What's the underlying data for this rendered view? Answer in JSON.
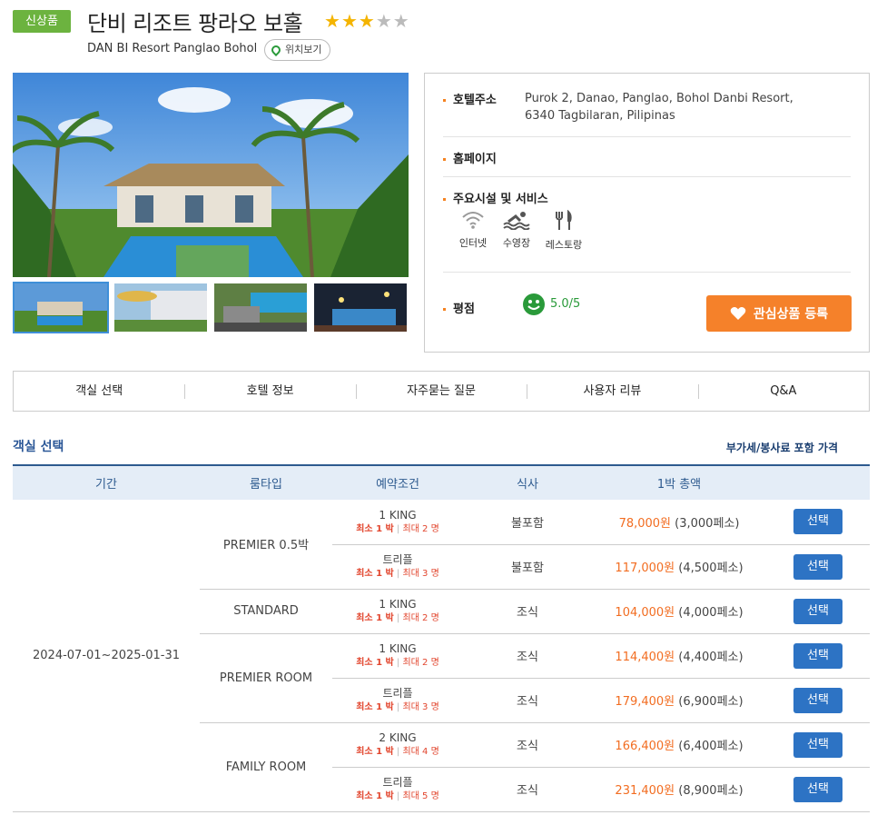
{
  "header": {
    "badge": "신상품",
    "title": "단비 리조트 팡라오 보홀",
    "subtitle": "DAN BI Resort Panglao Bohol",
    "map_button": "위치보기",
    "stars_filled": 3,
    "stars_total": 5
  },
  "info": {
    "address_label": "호텔주소",
    "address_line1": "Purok 2, Danao, Panglao, Bohol Danbi Resort,",
    "address_line2": "6340 Tagbilaran, Pilipinas",
    "homepage_label": "홈페이지",
    "services_label": "주요시설 및 서비스",
    "facilities": [
      {
        "icon": "wifi-icon",
        "label": "인터넷"
      },
      {
        "icon": "pool-icon",
        "label": "수영장"
      },
      {
        "icon": "restaurant-icon",
        "label": "레스토랑"
      }
    ],
    "rating_label": "평점",
    "rating_value": "5.0/5",
    "favorite_button": "관심상품 등록"
  },
  "tabs": [
    "객실 선택",
    "호텔 정보",
    "자주묻는 질문",
    "사용자 리뷰",
    "Q&A"
  ],
  "rooms": {
    "section_title": "객실 선택",
    "vat_note": "부가세/봉사료 포함 가격",
    "headers": [
      "기간",
      "룸타입",
      "예약조건",
      "식사",
      "1박 총액",
      ""
    ],
    "period": "2024-07-01~2025-01-31",
    "select_label": "선택",
    "room_types": [
      {
        "name": "PREMIER 0.5박",
        "options": [
          {
            "bed": "1 KING",
            "min": "최소 1 박",
            "max": "최대 2 명",
            "meal": "불포함",
            "price": "78,000원",
            "tax": "(3,000페소)"
          },
          {
            "bed": "트리플",
            "min": "최소 1 박",
            "max": "최대 3 명",
            "meal": "불포함",
            "price": "117,000원",
            "tax": "(4,500페소)"
          }
        ]
      },
      {
        "name": "STANDARD",
        "options": [
          {
            "bed": "1 KING",
            "min": "최소 1 박",
            "max": "최대 2 명",
            "meal": "조식",
            "price": "104,000원",
            "tax": "(4,000페소)"
          }
        ]
      },
      {
        "name": "PREMIER ROOM",
        "options": [
          {
            "bed": "1 KING",
            "min": "최소 1 박",
            "max": "최대 2 명",
            "meal": "조식",
            "price": "114,400원",
            "tax": "(4,400페소)"
          },
          {
            "bed": "트리플",
            "min": "최소 1 박",
            "max": "최대 3 명",
            "meal": "조식",
            "price": "179,400원",
            "tax": "(6,900페소)"
          }
        ]
      },
      {
        "name": "FAMILY ROOM",
        "options": [
          {
            "bed": "2 KING",
            "min": "최소 1 박",
            "max": "최대 4 명",
            "meal": "조식",
            "price": "166,400원",
            "tax": "(6,400페소)"
          },
          {
            "bed": "트리플",
            "min": "최소 1 박",
            "max": "최대 5 명",
            "meal": "조식",
            "price": "231,400원",
            "tax": "(8,900페소)"
          }
        ]
      }
    ]
  },
  "colors": {
    "badge": "#6cb33f",
    "star_filled": "#f4b400",
    "star_empty": "#bbbbbb",
    "accent_orange": "#f5812a",
    "price": "#f26d21",
    "select_button": "#2d73c4",
    "table_header": "#e4edf7",
    "rating_green": "#2a9a3a"
  }
}
